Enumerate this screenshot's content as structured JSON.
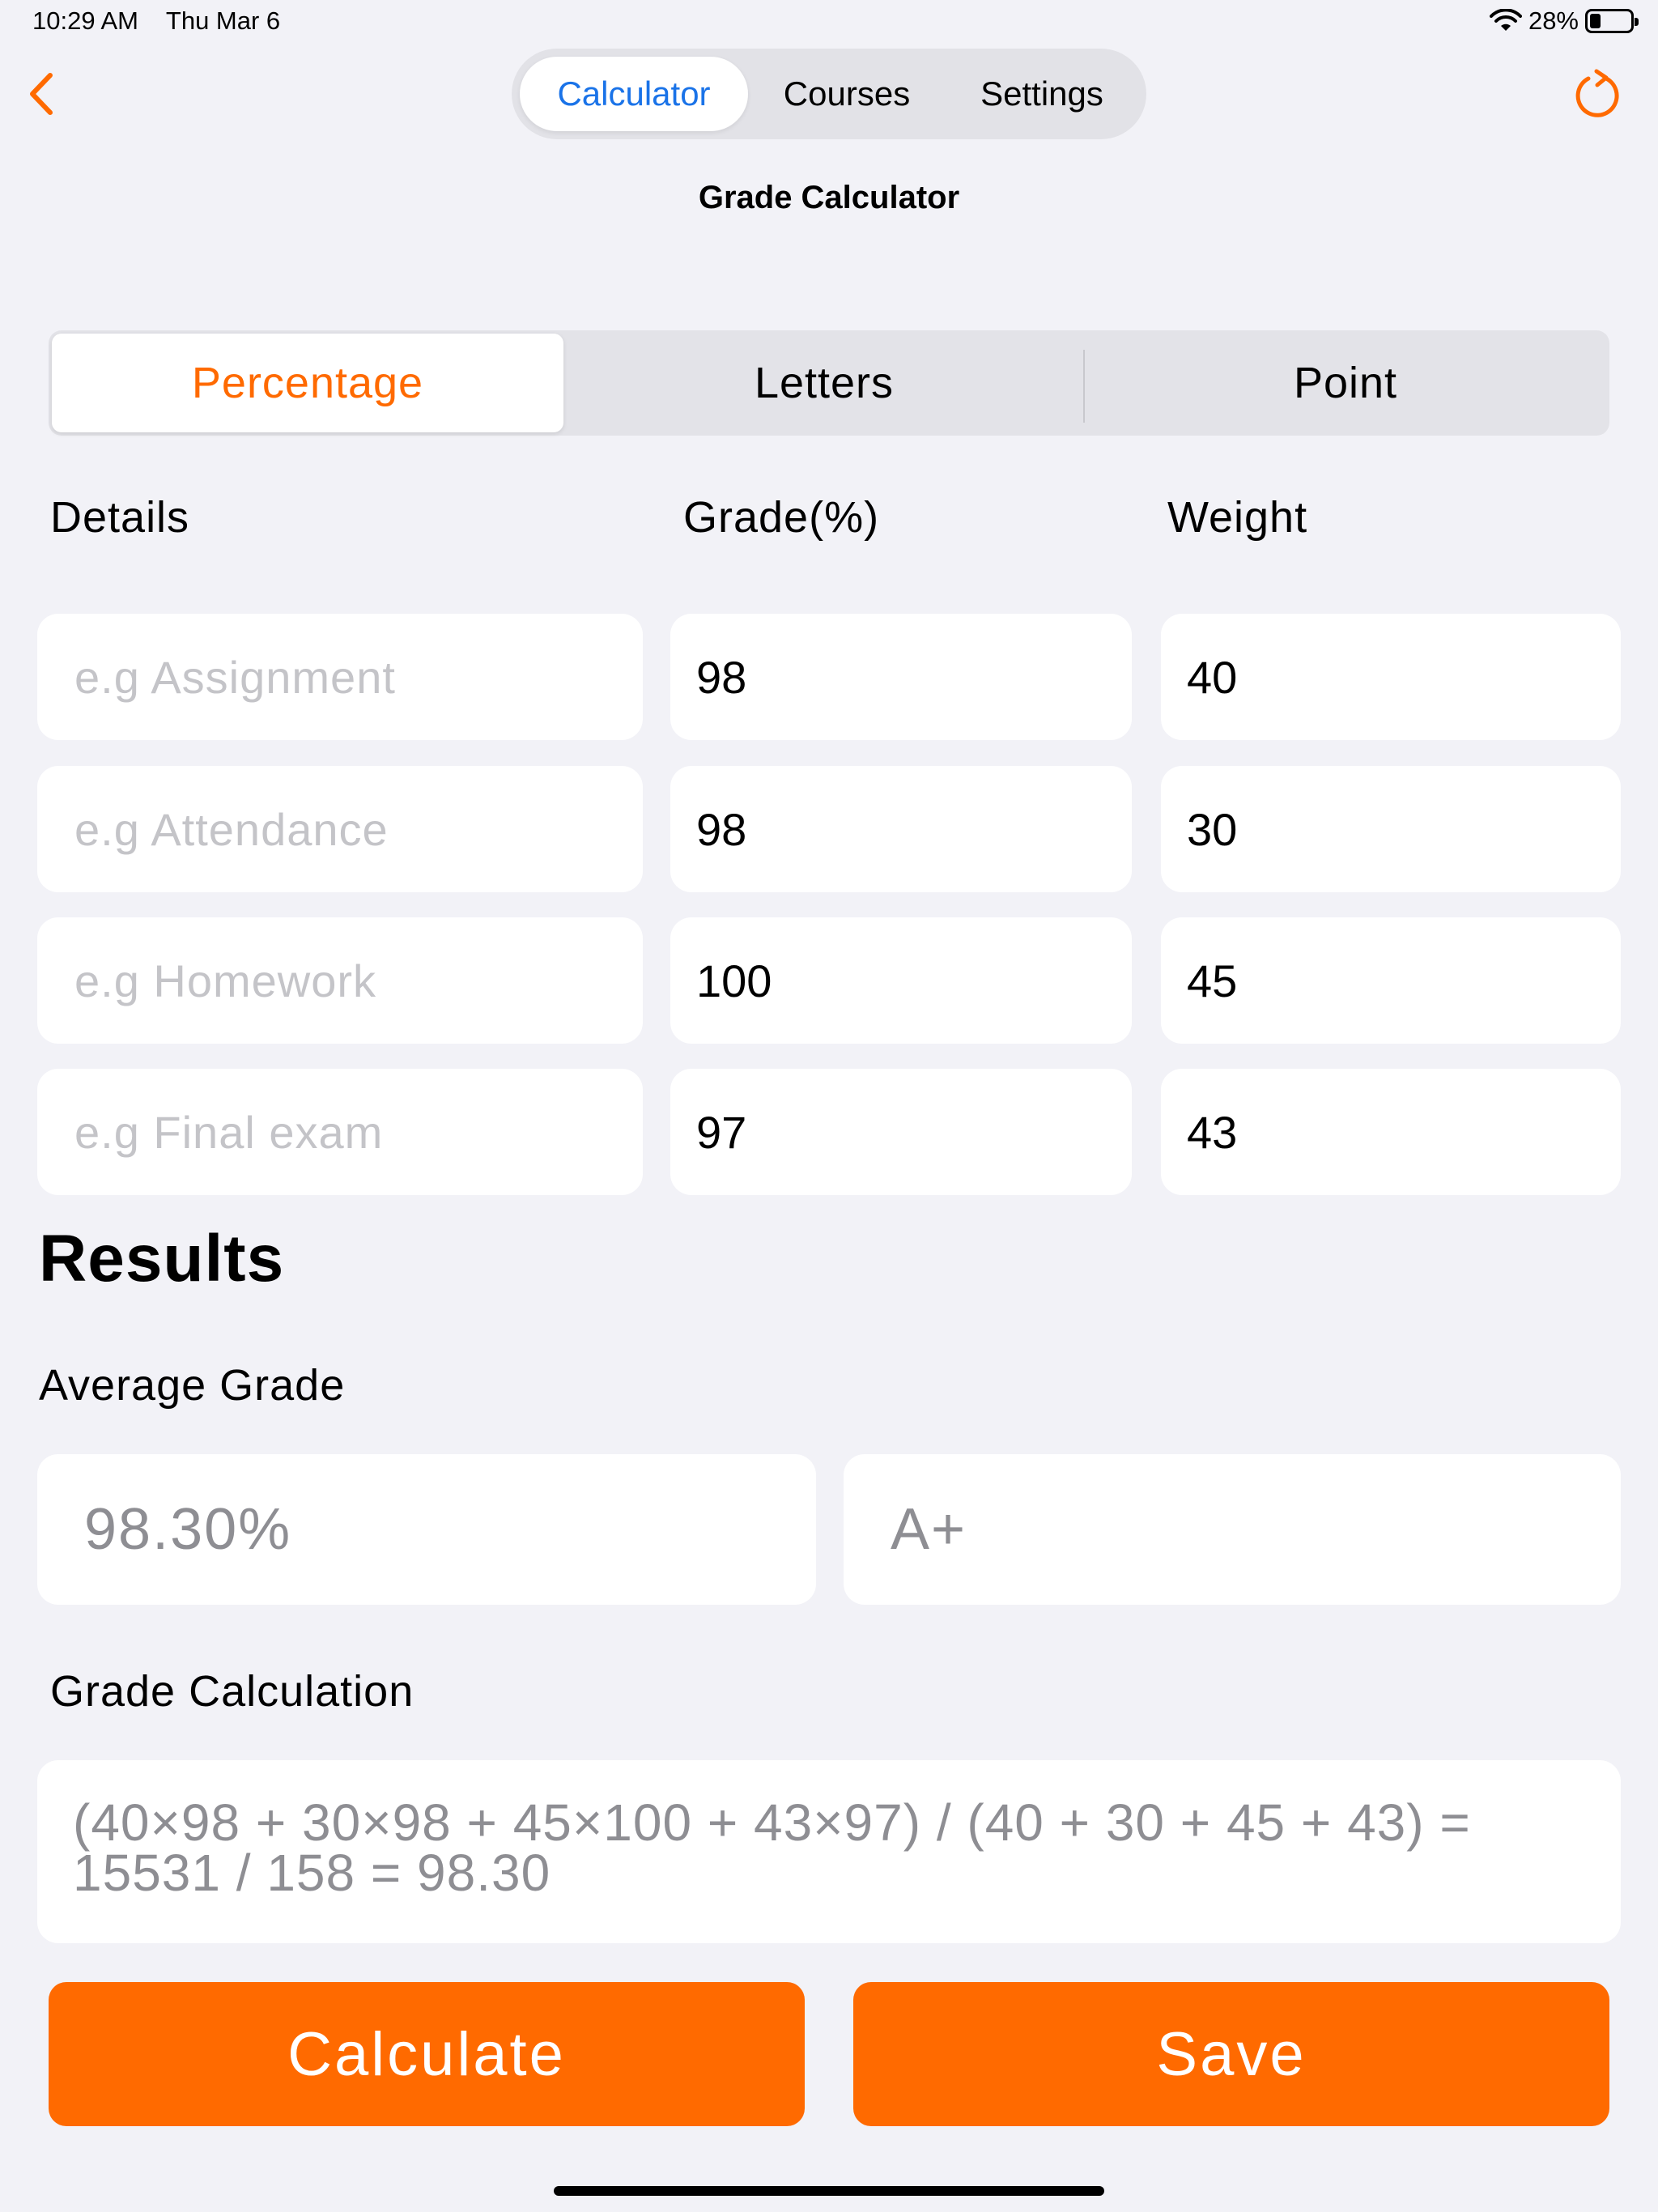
{
  "status_bar": {
    "time": "10:29 AM",
    "date": "Thu Mar 6",
    "battery_label": "28%",
    "battery_level": 0.28
  },
  "nav": {
    "tabs": [
      {
        "label": "Calculator"
      },
      {
        "label": "Courses"
      },
      {
        "label": "Settings"
      }
    ],
    "active_tab": "Calculator",
    "title": "Grade Calculator"
  },
  "grade_types": [
    {
      "label": "Percentage"
    },
    {
      "label": "Letters"
    },
    {
      "label": "Point"
    }
  ],
  "active_grade_type": "Percentage",
  "columns": {
    "details": "Details",
    "grade": "Grade(%)",
    "weight": "Weight"
  },
  "rows": [
    {
      "details_placeholder": "e.g Assignment",
      "grade": "98",
      "weight": "40"
    },
    {
      "details_placeholder": "e.g Attendance",
      "grade": "98",
      "weight": "30"
    },
    {
      "details_placeholder": "e.g Homework",
      "grade": "100",
      "weight": "45"
    },
    {
      "details_placeholder": "e.g Final exam",
      "grade": "97",
      "weight": "43"
    }
  ],
  "results": {
    "title": "Results",
    "average_label": "Average Grade",
    "average_percent": "98.30%",
    "average_letter": "A+",
    "calculation_label": "Grade Calculation",
    "calculation_line1": "(40×98 + 30×98 + 45×100 + 43×97) / (40 + 30 + 45 + 43) =",
    "calculation_line2": "15531 / 158 = 98.30"
  },
  "buttons": {
    "calculate": "Calculate",
    "save": "Save"
  },
  "colors": {
    "accent": "#ff6a00",
    "tab_active": "#1a73e8",
    "background": "#f2f2f7",
    "placeholder": "#c4c4c8",
    "result_text": "#8e8e93"
  },
  "icons": {
    "back": "chevron-left-icon",
    "refresh": "refresh-icon",
    "wifi": "wifi-icon",
    "battery": "battery-icon"
  }
}
